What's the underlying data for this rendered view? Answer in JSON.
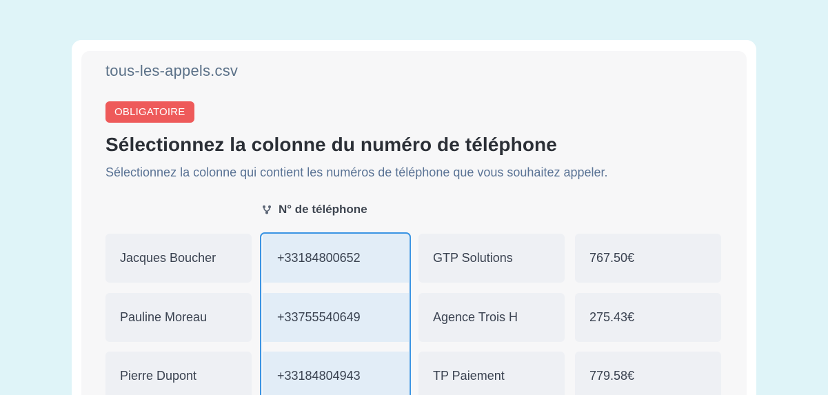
{
  "file": {
    "name": "tous-les-appels.csv"
  },
  "badge": {
    "label": "OBLIGATOIRE",
    "color": "#ee5a5a"
  },
  "heading": {
    "title": "Sélectionnez la colonne du numéro de téléphone",
    "subtitle": "Sélectionnez la colonne qui contient les numéros de téléphone que vous souhaitez appeler."
  },
  "column_header": {
    "icon": "branch-icon",
    "label": "N° de téléphone"
  },
  "accent_color": "#3b94e3",
  "rows": [
    {
      "name": "Jacques Boucher",
      "phone": "+33184800652",
      "company": "GTP Solutions",
      "amount": "767.50€"
    },
    {
      "name": "Pauline Moreau",
      "phone": "+33755540649",
      "company": "Agence Trois H",
      "amount": "275.43€"
    },
    {
      "name": "Pierre Dupont",
      "phone": "+33184804943",
      "company": "TP Paiement",
      "amount": "779.58€"
    }
  ]
}
